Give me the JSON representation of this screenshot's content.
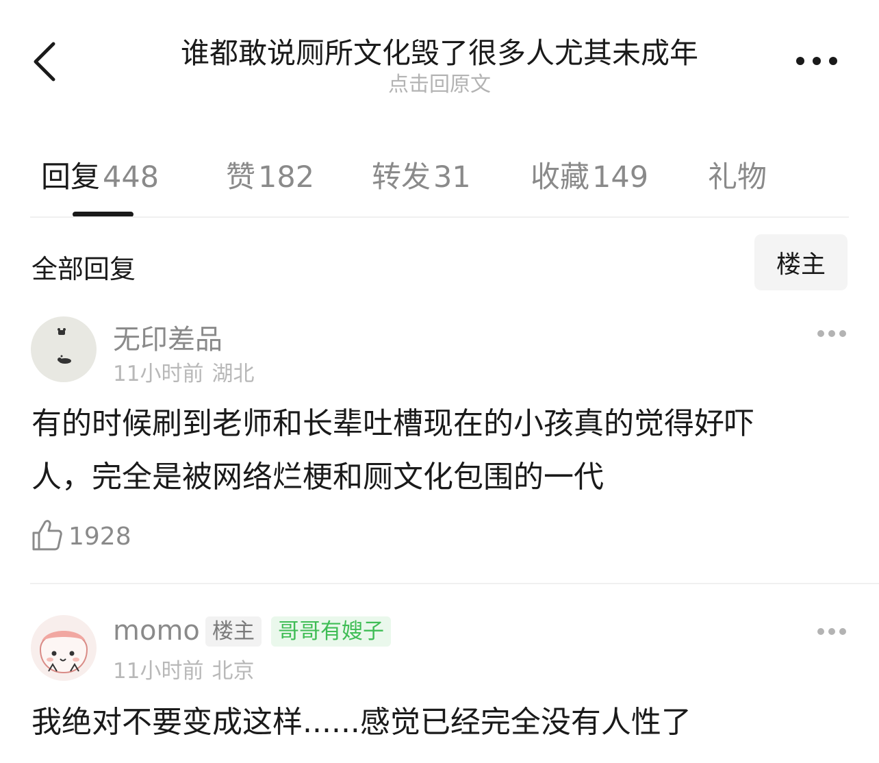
{
  "header": {
    "title": "谁都敢说厕所文化毁了很多人尤其未成年",
    "subtitle": "点击回原文"
  },
  "tabs": [
    {
      "label": "回复",
      "count": "448",
      "active": true
    },
    {
      "label": "赞",
      "count": "182"
    },
    {
      "label": "转发",
      "count": "31"
    },
    {
      "label": "收藏",
      "count": "149"
    },
    {
      "label": "礼物",
      "count": ""
    }
  ],
  "section": {
    "title": "全部回复",
    "owner_filter": "楼主"
  },
  "comments": [
    {
      "username": "无印差品",
      "time": "11小时前",
      "location": "湖北",
      "text_line1": "有的时候刷到老师和长辈吐槽现在的小孩真的觉得好吓",
      "text_line2": "人，完全是被网络烂梗和厕文化包围的一代",
      "likes": "1928"
    },
    {
      "username": "momo",
      "badge_owner": "楼主",
      "badge_tag": "哥哥有嫂子",
      "time": "11小时前",
      "location": "北京",
      "text_line1": "我绝对不要变成这样......感觉已经完全没有人性了"
    }
  ],
  "colors": {
    "text_primary": "#1a1a1a",
    "text_secondary": "#8a8a8a",
    "text_tertiary": "#b8b8b8",
    "badge_green": "#3fbd55"
  }
}
